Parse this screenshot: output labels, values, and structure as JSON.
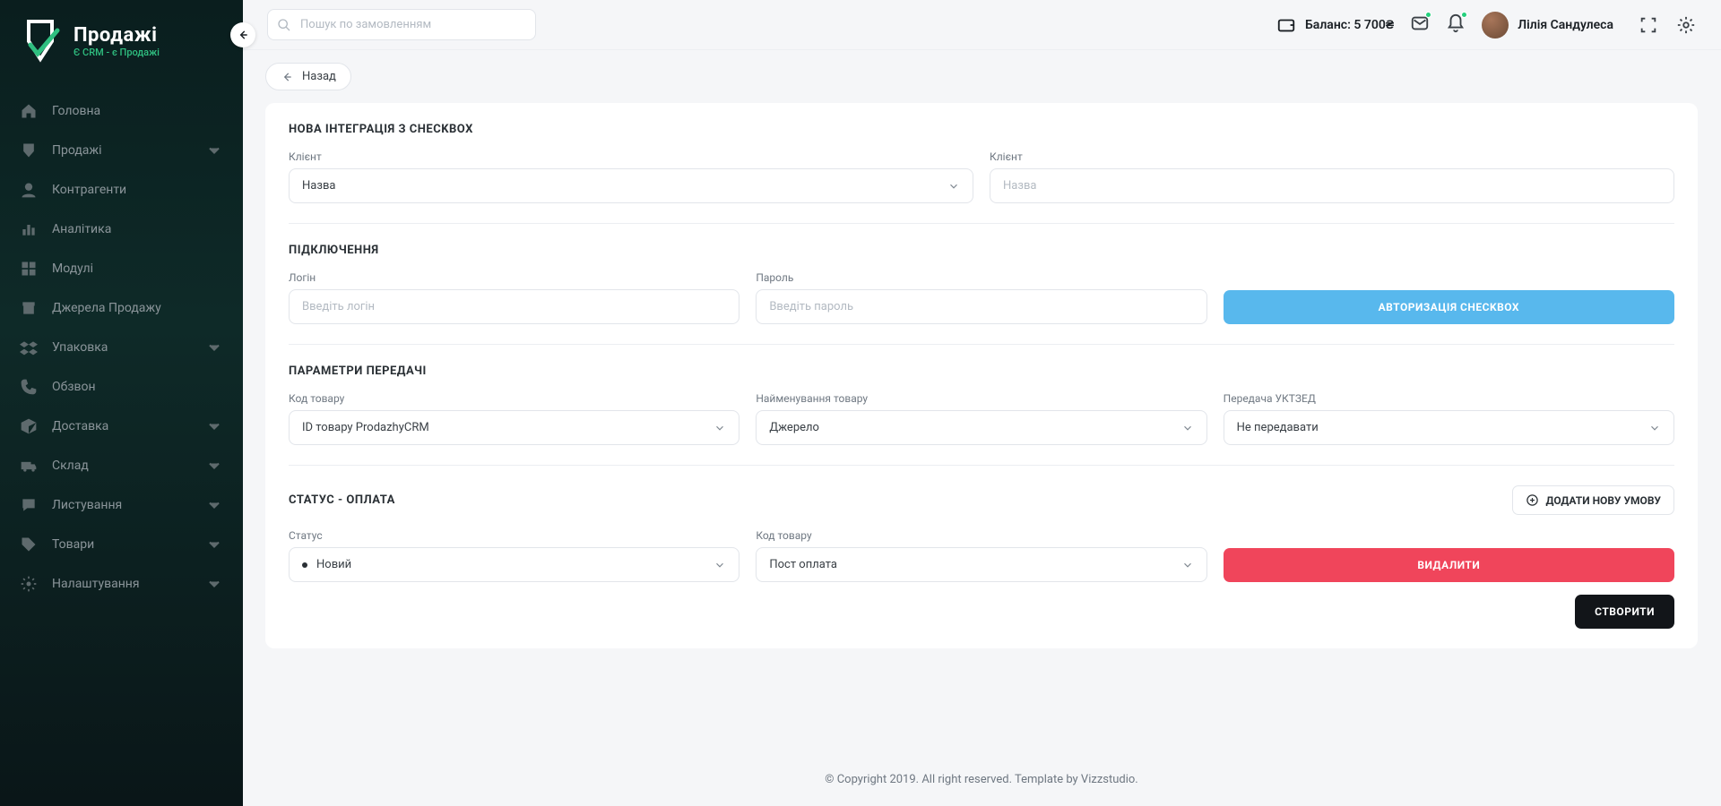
{
  "brand": {
    "title": "Продажі",
    "subtitle": "Є CRM - є Продажі"
  },
  "sidebar": {
    "items": [
      {
        "label": "Головна",
        "expandable": false
      },
      {
        "label": "Продажі",
        "expandable": true
      },
      {
        "label": "Контрагенти",
        "expandable": false
      },
      {
        "label": "Аналітика",
        "expandable": false
      },
      {
        "label": "Модулі",
        "expandable": false
      },
      {
        "label": "Джерела Продажу",
        "expandable": false
      },
      {
        "label": "Упаковка",
        "expandable": true
      },
      {
        "label": "Обзвон",
        "expandable": false
      },
      {
        "label": "Доставка",
        "expandable": true
      },
      {
        "label": "Склад",
        "expandable": true
      },
      {
        "label": "Листування",
        "expandable": true
      },
      {
        "label": "Товари",
        "expandable": true
      },
      {
        "label": "Налаштування",
        "expandable": true
      }
    ]
  },
  "topbar": {
    "search_placeholder": "Пошук по замовленням",
    "balance_prefix": "Баланс:",
    "balance_value": "5 700₴",
    "user_name": "Лілія Сандулеса"
  },
  "page": {
    "back_label": "Назад",
    "section_integration_title": "НОВА ІНТЕГРАЦІЯ З CHECKBOX",
    "client_label": "Клієнт",
    "client2_label": "Клієнт",
    "client_select_value": "Назва",
    "client_input_placeholder": "Назва",
    "section_connection_title": "ПІДКЛЮЧЕННЯ",
    "login_label": "Логін",
    "login_placeholder": "Введіть логін",
    "password_label": "Пароль",
    "password_placeholder": "Введіть пароль",
    "auth_button": "АВТОРИЗАЦІЯ CHECKBOX",
    "section_params_title": "ПАРАМЕТРИ ПЕРЕДАЧІ",
    "product_code_label": "Код товару",
    "product_code_value": "ID товару ProdazhyCRM",
    "product_name_label": "Найменування товару",
    "product_name_value": "Джерело",
    "uktzed_label": "Передача УКТЗЕД",
    "uktzed_value": "Не передавати",
    "section_status_title": "СТАТУС - ОПЛАТА",
    "add_condition_label": "ДОДАТИ НОВУ УМОВУ",
    "status_field_label": "Статус",
    "status_value": "Новий",
    "product_code2_label": "Код товару",
    "product_code2_value": "Пост оплата",
    "delete_button": "ВИДАЛИТИ",
    "create_button": "СТВОРИТИ"
  },
  "footer": {
    "text": "© Copyright 2019. All right reserved. Template by Vizzstudio."
  }
}
